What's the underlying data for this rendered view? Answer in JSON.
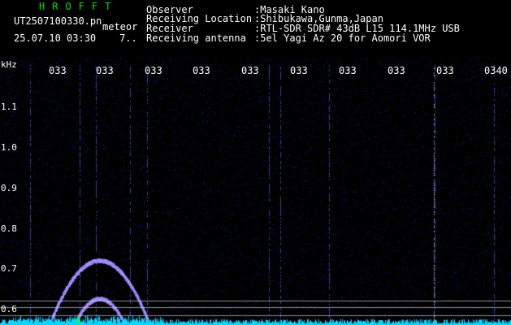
{
  "app": {
    "title": "HROFFT"
  },
  "file": {
    "name": "UT2507100330.pn",
    "kind": "meteor",
    "timestamp": "25.07.10 03:30",
    "extra": "7.."
  },
  "info": [
    {
      "label": "Observer",
      "value": ":Masaki Kano"
    },
    {
      "label": "Receiving Location",
      "value": ":Shibukawa,Gunma,Japan"
    },
    {
      "label": "Receiver",
      "value": ":RTL-SDR SDR# 43dB L15 114.1MHz USB"
    },
    {
      "label": "Receiving antenna",
      "value": ":5el Yagi Az 20 for Aomori VOR"
    }
  ],
  "y_axis": {
    "unit": "kHz",
    "ticks": [
      "1.1",
      "1.0",
      "0.9",
      "0.8",
      "0.7",
      "0.6"
    ]
  },
  "x_axis": {
    "ticks": [
      "033",
      "033",
      "033",
      "033",
      "033",
      "033",
      "033",
      "033",
      "033",
      "0340"
    ]
  },
  "colors": {
    "background": "#000000",
    "noise": "#1a2aa0",
    "signal": "#00e0ff",
    "header_accent": "#00e000",
    "grid": "#c8c8c8"
  }
}
